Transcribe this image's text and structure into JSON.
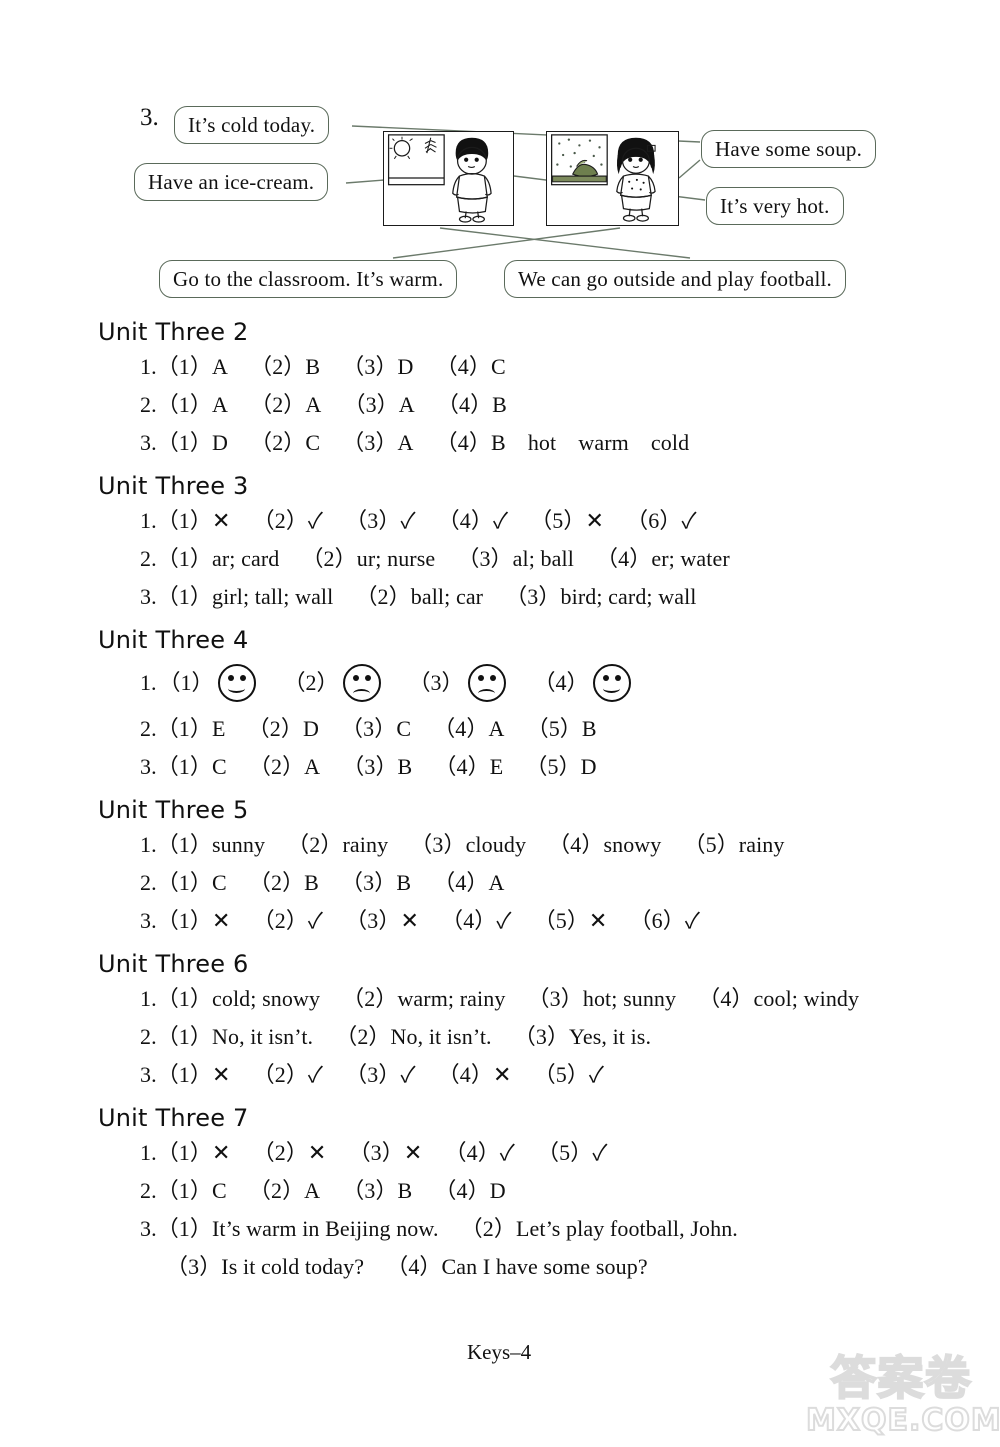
{
  "exercise": {
    "number": "3.",
    "bubbles": {
      "cold": "It’s cold today.",
      "ice_cream": "Have an ice-cream.",
      "soup": "Have some soup.",
      "very_hot": "It’s very hot.",
      "classroom": "Go to the classroom. It’s warm.",
      "football": "We can go outside and play football."
    },
    "panels": [
      {
        "name": "boy-sunny-window",
        "character": "boy",
        "window": "sunny"
      },
      {
        "name": "girl-snowy-window",
        "character": "girl",
        "window": "snowy"
      }
    ]
  },
  "units": [
    {
      "title": "Unit Three 2",
      "lines": [
        "1.（1）A （2）B （3）D （4）C",
        "2.（1）A （2）A （3）A （4）B",
        "3.（1）D （2）C （3）A （4）B hot warm cold"
      ]
    },
    {
      "title": "Unit Three 3",
      "lines": [
        "1.（1）✕ （2）✓ （3）✓ （4）✓ （5）✕ （6）✓",
        "2.（1）ar; card （2）ur; nurse （3）al; ball （4）er; water",
        "3.（1）girl; tall; wall （2）ball; car （3）bird; card; wall"
      ]
    },
    {
      "title": "Unit Three 4",
      "faces": {
        "prefix": "1.",
        "items": [
          {
            "label": "（1）",
            "face": "happy"
          },
          {
            "label": "（2）",
            "face": "sad"
          },
          {
            "label": "（3）",
            "face": "sad"
          },
          {
            "label": "（4）",
            "face": "happy"
          }
        ]
      },
      "lines": [
        "2.（1）E （2）D （3）C （4）A （5）B",
        "3.（1）C （2）A （3）B （4）E （5）D"
      ]
    },
    {
      "title": "Unit Three 5",
      "lines": [
        "1.（1）sunny （2）rainy （3）cloudy （4）snowy （5）rainy",
        "2.（1）C （2）B （3）B （4）A",
        "3.（1）✕ （2）✓ （3）✕ （4）✓ （5）✕ （6）✓"
      ]
    },
    {
      "title": "Unit Three 6",
      "lines": [
        "1.（1）cold; snowy （2）warm; rainy （3）hot; sunny （4）cool; windy",
        "2.（1）No, it isn’t. （2）No, it isn’t. （3）Yes, it is.",
        "3.（1）✕ （2）✓ （3）✓ （4）✕ （5）✓"
      ]
    },
    {
      "title": "Unit Three 7",
      "lines": [
        "1.（1）✕ （2）✕ （3）✕ （4）✓ （5）✓",
        "2.（1）C （2）A （3）B （4）D",
        "3.（1）It’s warm in Beijing now. （2）Let’s play football, John."
      ],
      "extra_line": "（3）Is it cold today? （4）Can I have some soup?"
    }
  ],
  "footer": {
    "page_label": "Keys–4"
  },
  "watermark": {
    "chinese": "答案卷",
    "domain": "MXQE.COM"
  }
}
